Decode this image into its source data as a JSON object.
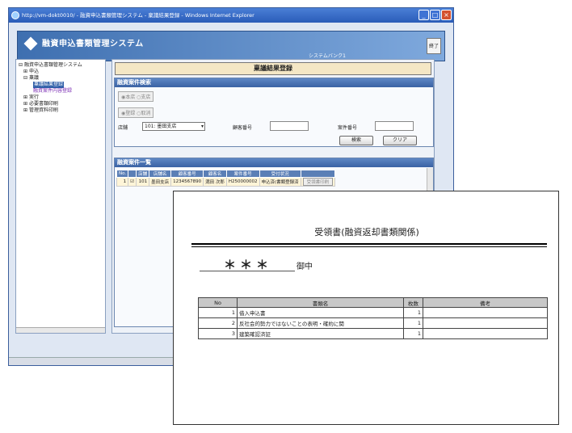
{
  "browser": {
    "title": "http://vm-dokt0010/ - 融資申込書類管理システム - 稟議結果登録 - Windows Internet Explorer"
  },
  "app": {
    "title": "融資申込書類管理システム",
    "subtitle": "システムバンク1",
    "exit_label": "終了"
  },
  "sidebar": {
    "root": "融資申込書類管理システム",
    "items": [
      {
        "label": "申込",
        "level": 1
      },
      {
        "label": "稟議",
        "level": 1
      },
      {
        "label": "稟議結果登録",
        "level": 2,
        "selected": true
      },
      {
        "label": "融資案件内容登録",
        "level": 2,
        "link": true
      },
      {
        "label": "実行",
        "level": 1
      },
      {
        "label": "必要書類印刷",
        "level": 1
      },
      {
        "label": "管理資料印刷",
        "level": 1
      }
    ]
  },
  "main": {
    "page_title": "稟議結果登録",
    "search": {
      "header": "融資案件検索",
      "radio1": [
        "本店",
        "支店"
      ],
      "radio2": [
        "登録",
        "取消"
      ],
      "branch_label": "店舗",
      "branch_value": "101: 墨田支店",
      "customer_label": "顧客番号",
      "case_label": "案件番号",
      "search_button": "検索",
      "clear_button": "クリア"
    },
    "list": {
      "header": "融資案件一覧",
      "columns": [
        "No.",
        "",
        "店舗",
        "店舗名",
        "顧客番号",
        "顧客名",
        "案件番号",
        "受付状況",
        ""
      ],
      "rows": [
        {
          "no": "1",
          "branch": "101",
          "branch_name": "墨田支店",
          "customer_no": "1234567890",
          "customer_name": "満田 次郎",
          "case_no": "H250000002",
          "status": "申込済(書類登録済",
          "action": "受領書印刷"
        }
      ]
    }
  },
  "receipt": {
    "title": "受領書(融資返却書類関係)",
    "addressee": "＊＊＊",
    "honorific": "御中",
    "columns": [
      "No",
      "書類名",
      "枚数",
      "備考"
    ],
    "rows": [
      {
        "no": "1",
        "name": "借入申込書",
        "count": "1",
        "note": ""
      },
      {
        "no": "2",
        "name": "反社会的勢力ではないことの表明・確約に関",
        "count": "1",
        "note": ""
      },
      {
        "no": "3",
        "name": "建築確認済証",
        "count": "1",
        "note": ""
      }
    ]
  }
}
